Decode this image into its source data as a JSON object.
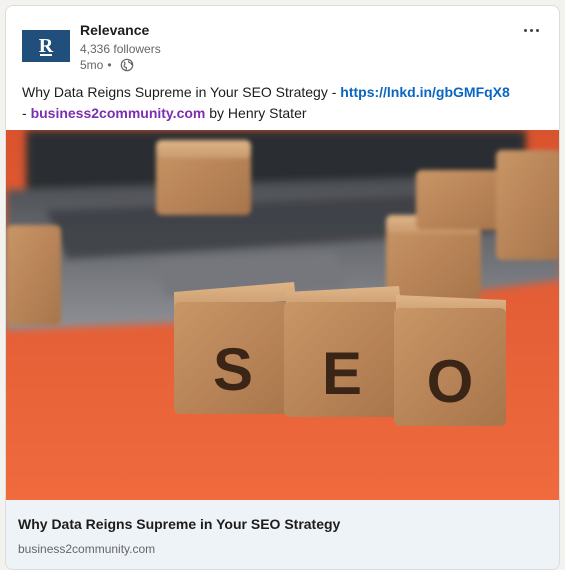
{
  "post": {
    "company_name": "Relevance",
    "logo_letter": "R",
    "followers": "4,336 followers",
    "age": "5mo",
    "separator": "•",
    "text_prefix": "Why Data Reigns Supreme in Your SEO Strategy -",
    "short_link": "https://lnkd.in/gbGMFqX8",
    "text_dash": "-",
    "site_link": "business2community.com",
    "text_suffix": "by Henry Stater",
    "visibility_icon": "globe-icon",
    "more_icon": "ellipsis-icon"
  },
  "image": {
    "blocks": [
      "S",
      "E",
      "O"
    ],
    "background_color": "#e8542f"
  },
  "preview": {
    "title": "Why Data Reigns Supreme in Your SEO Strategy",
    "source": "business2community.com"
  },
  "colors": {
    "link": "#0a66c2",
    "visited_link": "#7b2fb0",
    "logo_bg": "#1f4f7a"
  }
}
